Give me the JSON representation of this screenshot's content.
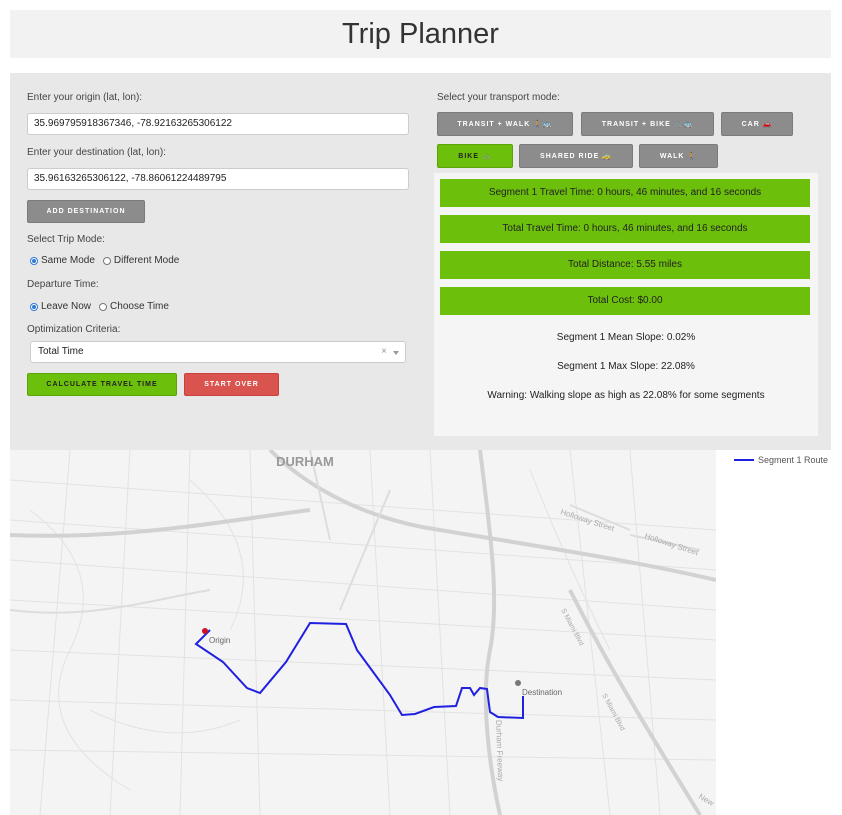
{
  "title": "Trip Planner",
  "origin": {
    "label": "Enter your origin (lat, lon):",
    "value": "35.969795918367346, -78.92163265306122"
  },
  "destination": {
    "label": "Enter your destination (lat, lon):",
    "value": "35.96163265306122, -78.86061224489795"
  },
  "add_destination_label": "ADD DESTINATION",
  "trip_mode": {
    "label": "Select Trip Mode:",
    "options": [
      "Same Mode",
      "Different Mode"
    ],
    "selected": "Same Mode"
  },
  "departure": {
    "label": "Departure Time:",
    "options": [
      "Leave Now",
      "Choose Time"
    ],
    "selected": "Leave Now"
  },
  "optimization": {
    "label": "Optimization Criteria:",
    "value": "Total Time",
    "clear": "×"
  },
  "calculate_label": "CALCULATE TRAVEL TIME",
  "start_over_label": "START OVER",
  "transport": {
    "label": "Select your transport mode:",
    "modes": [
      {
        "label": "TRANSIT + WALK 🚶🚌",
        "selected": false
      },
      {
        "label": "TRANSIT + BIKE 🚲🚌",
        "selected": false
      },
      {
        "label": "CAR 🚗",
        "selected": false
      },
      {
        "label": "BIKE 🚲",
        "selected": true
      },
      {
        "label": "SHARED RIDE 🚕",
        "selected": false
      },
      {
        "label": "WALK 🚶",
        "selected": false
      }
    ]
  },
  "results": {
    "segment_travel_time": "Segment 1 Travel Time: 0 hours, 46 minutes, and 16 seconds",
    "total_travel_time": "Total Travel Time: 0 hours, 46 minutes, and 16 seconds",
    "total_distance": "Total Distance: 5.55 miles",
    "total_cost": "Total Cost: $0.00",
    "mean_slope": "Segment 1 Mean Slope: 0.02%",
    "max_slope": "Segment 1 Max Slope: 22.08%",
    "warning": "Warning: Walking slope as high as 22.08% for some segments"
  },
  "map": {
    "labels": {
      "city": "DURHAM",
      "holloway_1": "Holloway Street",
      "holloway_2": "Holloway Street",
      "miami_1": "S Miami Blvd",
      "miami_2": "S Miami Blvd",
      "freeway": "Durham Freeway",
      "new": "New",
      "origin": "Origin",
      "destination": "Destination"
    },
    "route_color": "#2020e0",
    "origin_color": "#cc1122",
    "destination_color": "#777777"
  },
  "legend": {
    "route_label": "Segment 1 Route"
  }
}
